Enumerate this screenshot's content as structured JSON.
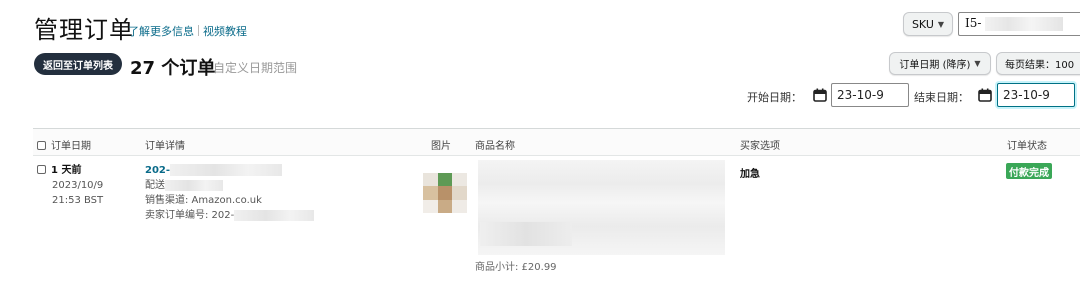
{
  "header": {
    "title": "管理订单",
    "learn_more": "了解更多信息",
    "video": "视频教程"
  },
  "search": {
    "field_select": "SKU",
    "value": "I5-"
  },
  "toolbar": {
    "back_label": "返回至订单列表",
    "order_count": "27 个订单",
    "range_label": "自定义日期范围",
    "sort_label": "订单日期 (降序)",
    "per_page_label": "每页结果：100"
  },
  "dates": {
    "start_label": "开始日期：",
    "start_value": "23-10-9",
    "end_label": "结束日期：",
    "end_value": "23-10-9"
  },
  "table": {
    "columns": [
      "订单日期",
      "订单详情",
      "图片",
      "商品名称",
      "买家选项",
      "订单状态"
    ],
    "rows": [
      {
        "relative_date": "1 天前",
        "date": "2023/10/9",
        "time": "21:53 BST",
        "order_id": "202-",
        "delivery_prefix": "配送",
        "channel": "销售渠道: Amazon.co.uk",
        "seller_order": "卖家订单编号: 202-",
        "subtotal": "商品小计: £20.99",
        "buyer_option": "加急",
        "status": "付款完成"
      }
    ]
  },
  "colors": {
    "accent_dark": "#232f3e",
    "link": "#0a6b8a",
    "status_green": "#3aa757"
  }
}
